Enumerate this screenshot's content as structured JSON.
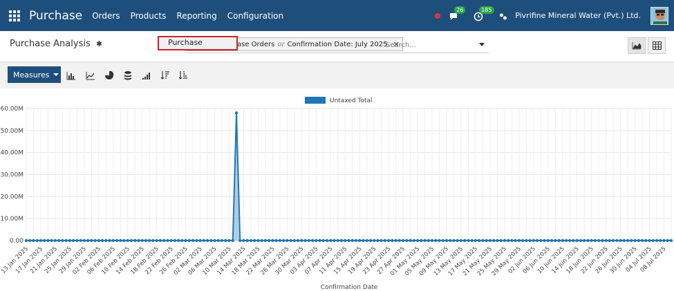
{
  "navbar": {
    "brand": "Purchase",
    "menus": [
      "Orders",
      "Products",
      "Reporting",
      "Configuration"
    ],
    "messages_count": "26",
    "activities_count": "185",
    "company": "Pivrifine Mineral Water (Pvt.) Ltd.",
    "colors": {
      "bar": "#1e4f7c",
      "badge": "#28a745",
      "status": "#e0343d"
    }
  },
  "control": {
    "title": "Purchase Analysis",
    "facet_part1": "ase Orders",
    "facet_or": "or",
    "facet_part2": "Confirmation Date: July 2025",
    "search_placeholder": "Search...",
    "popup_label": "Purchase"
  },
  "toolbar": {
    "measures_label": "Measures",
    "icons": [
      "bar-chart-icon",
      "line-chart-icon",
      "pie-chart-icon",
      "stack-icon",
      "cumulative-icon",
      "sort-desc-icon",
      "sort-asc-icon"
    ]
  },
  "chart_data": {
    "type": "line",
    "title": "",
    "xlabel": "Confirmation Date",
    "ylabel": "",
    "legend": "Untaxed Total",
    "legend_position": "top-center",
    "color": "#1f77b4",
    "grid": true,
    "ylim": [
      0,
      60000000
    ],
    "yticks": [
      "0.00",
      "10.00M",
      "20.00M",
      "30.00M",
      "40.00M",
      "50.00M",
      "60.00M"
    ],
    "x_start": "2025-01-13",
    "x_end": "2025-07-10",
    "xtick_labels": [
      "13 Jan 2025",
      "17 Jan 2025",
      "21 Jan 2025",
      "25 Jan 2025",
      "29 Jan 2025",
      "02 Feb 2025",
      "06 Feb 2025",
      "10 Feb 2025",
      "14 Feb 2025",
      "18 Feb 2025",
      "22 Feb 2025",
      "26 Feb 2025",
      "02 Mar 2025",
      "06 Mar 2025",
      "10 Mar 2025",
      "14 Mar 2025",
      "18 Mar 2025",
      "22 Mar 2025",
      "26 Mar 2025",
      "30 Mar 2025",
      "03 Apr 2025",
      "07 Apr 2025",
      "11 Apr 2025",
      "15 Apr 2025",
      "19 Apr 2025",
      "23 Apr 2025",
      "27 Apr 2025",
      "01 May 2025",
      "05 May 2025",
      "09 May 2025",
      "13 May 2025",
      "17 May 2025",
      "21 May 2025",
      "25 May 2025",
      "29 May 2025",
      "02 Jun 2025",
      "06 Jun 2025",
      "10 Jun 2025",
      "14 Jun 2025",
      "18 Jun 2025",
      "22 Jun 2025",
      "26 Jun 2025",
      "30 Jun 2025",
      "04 Jul 2025",
      "08 Jul 2025"
    ],
    "points": [
      {
        "x": "2025-03-12",
        "y": 58000000
      }
    ],
    "baseline_value": 0
  }
}
